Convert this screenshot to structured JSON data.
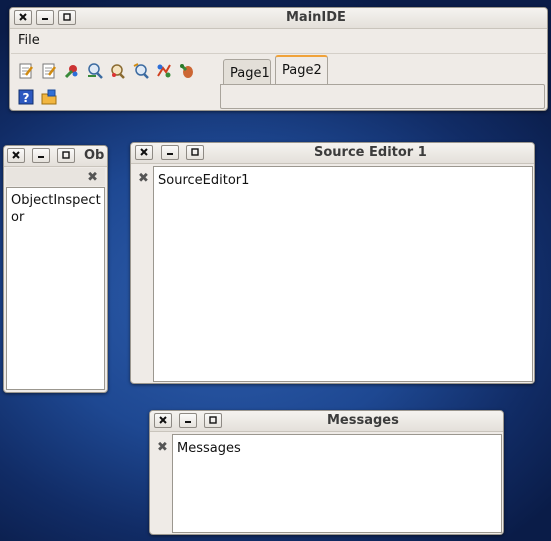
{
  "main_ide": {
    "title": "MainIDE",
    "menu": {
      "file": "File"
    },
    "toolbar_icons": [
      "new-unit-icon",
      "new-form-icon",
      "run-icon",
      "find-icon",
      "find-in-files-icon",
      "replace-icon",
      "jump-icon",
      "debug-icon",
      "help-icon",
      "open-package-icon"
    ],
    "tabs": [
      {
        "label": "Page1",
        "active": false
      },
      {
        "label": "Page2",
        "active": true
      }
    ]
  },
  "object_inspector": {
    "title": "Ob",
    "content": "ObjectInspector"
  },
  "source_editor": {
    "title": "Source Editor 1",
    "content": "SourceEditor1"
  },
  "messages": {
    "title": "Messages",
    "content": "Messages"
  },
  "window_buttons": {
    "close": "✕",
    "minimize": "_",
    "maximize": "□"
  },
  "colors": {
    "accent_tab": "#f0a23a",
    "window_bg": "#efebe7",
    "desktop": "#1e4892"
  }
}
